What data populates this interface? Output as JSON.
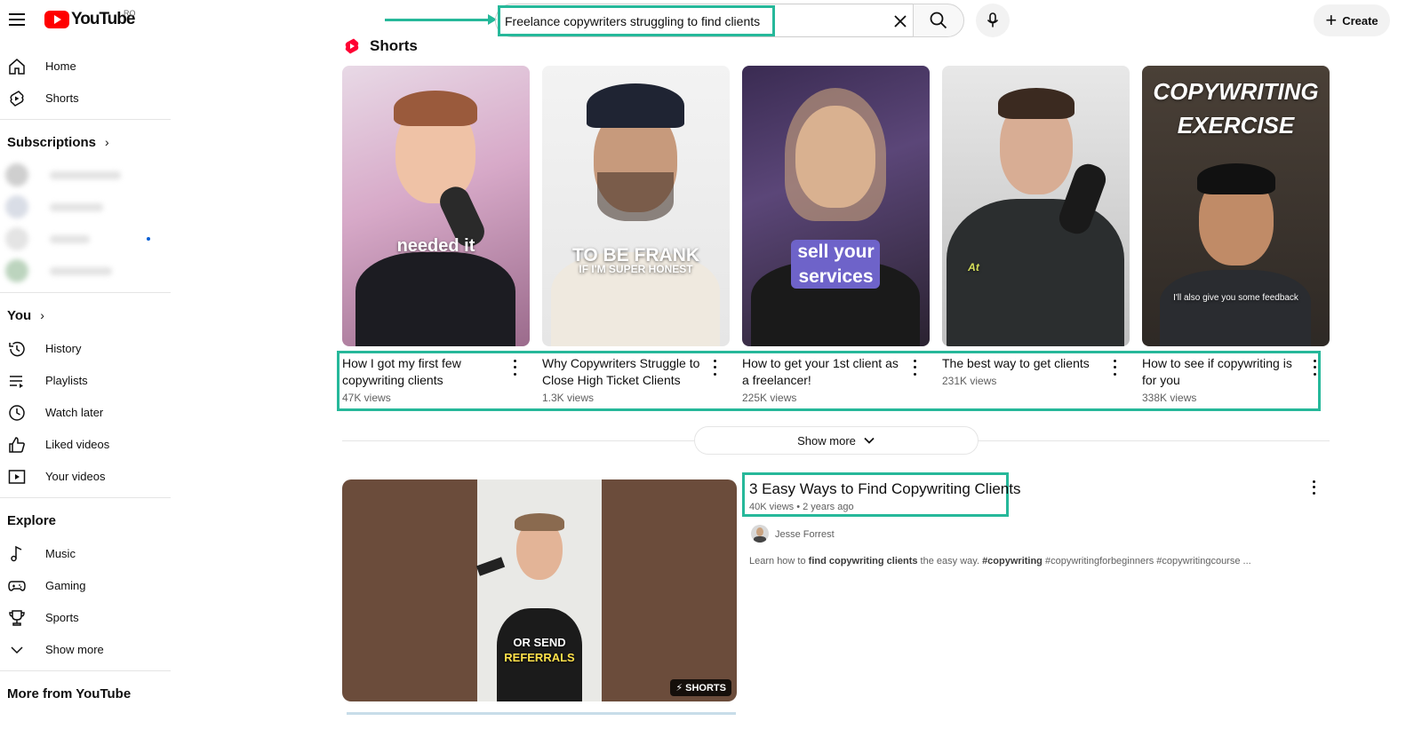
{
  "header": {
    "logo_text": "YouTube",
    "country_code": "RO",
    "search_value": "Freelance copywriters struggling to find clients",
    "create_label": "Create"
  },
  "sidebar": {
    "main": [
      {
        "label": "Home",
        "icon": "home-icon"
      },
      {
        "label": "Shorts",
        "icon": "shorts-icon"
      }
    ],
    "subscriptions_title": "Subscriptions",
    "you_title": "You",
    "you_items": [
      {
        "label": "History",
        "icon": "history-icon"
      },
      {
        "label": "Playlists",
        "icon": "playlists-icon"
      },
      {
        "label": "Watch later",
        "icon": "clock-icon"
      },
      {
        "label": "Liked videos",
        "icon": "thumbs-up-icon"
      },
      {
        "label": "Your videos",
        "icon": "your-videos-icon"
      }
    ],
    "explore_title": "Explore",
    "explore_items": [
      {
        "label": "Music",
        "icon": "music-icon"
      },
      {
        "label": "Gaming",
        "icon": "gaming-icon"
      },
      {
        "label": "Sports",
        "icon": "trophy-icon"
      },
      {
        "label": "Show more",
        "icon": "chevron-down-icon"
      }
    ],
    "more_from_title": "More from YouTube"
  },
  "shorts": {
    "section_title": "Shorts",
    "items": [
      {
        "title": "How I got my first few copywriting clients",
        "views": "47K views",
        "caption": "needed it"
      },
      {
        "title": "Why Copywriters Struggle to Close High Ticket Clients",
        "views": "1.3K views",
        "caption": "TO BE FRANK",
        "caption_sub": "IF I'M SUPER HONEST"
      },
      {
        "title": "How to get your 1st client as a freelancer!",
        "views": "225K views",
        "caption": "sell your services"
      },
      {
        "title": "The best way to get clients",
        "views": "231K views",
        "caption": "At"
      },
      {
        "title": "How to see if copywriting is for you",
        "views": "338K views",
        "caption": "COPYWRITING EXERCISE",
        "caption_sub": "I'll also give you some feedback"
      }
    ],
    "show_more_label": "Show more"
  },
  "video": {
    "title": "3 Easy Ways to Find Copywriting Clients",
    "meta": "40K views • 2 years ago",
    "channel": "Jesse Forrest",
    "desc_prefix": "Learn how to ",
    "desc_bold": "find copywriting clients",
    "desc_suffix": " the easy way. ",
    "desc_tags": "#copywriting",
    "desc_rest": " #copywritingforbeginners #copywritingcourse ...",
    "thumb_line1": "OR SEND",
    "thumb_line2": "REFERRALS",
    "shorts_tag": "SHORTS"
  },
  "colors": {
    "highlight": "#26b89a",
    "brand_red": "#ff0000"
  }
}
